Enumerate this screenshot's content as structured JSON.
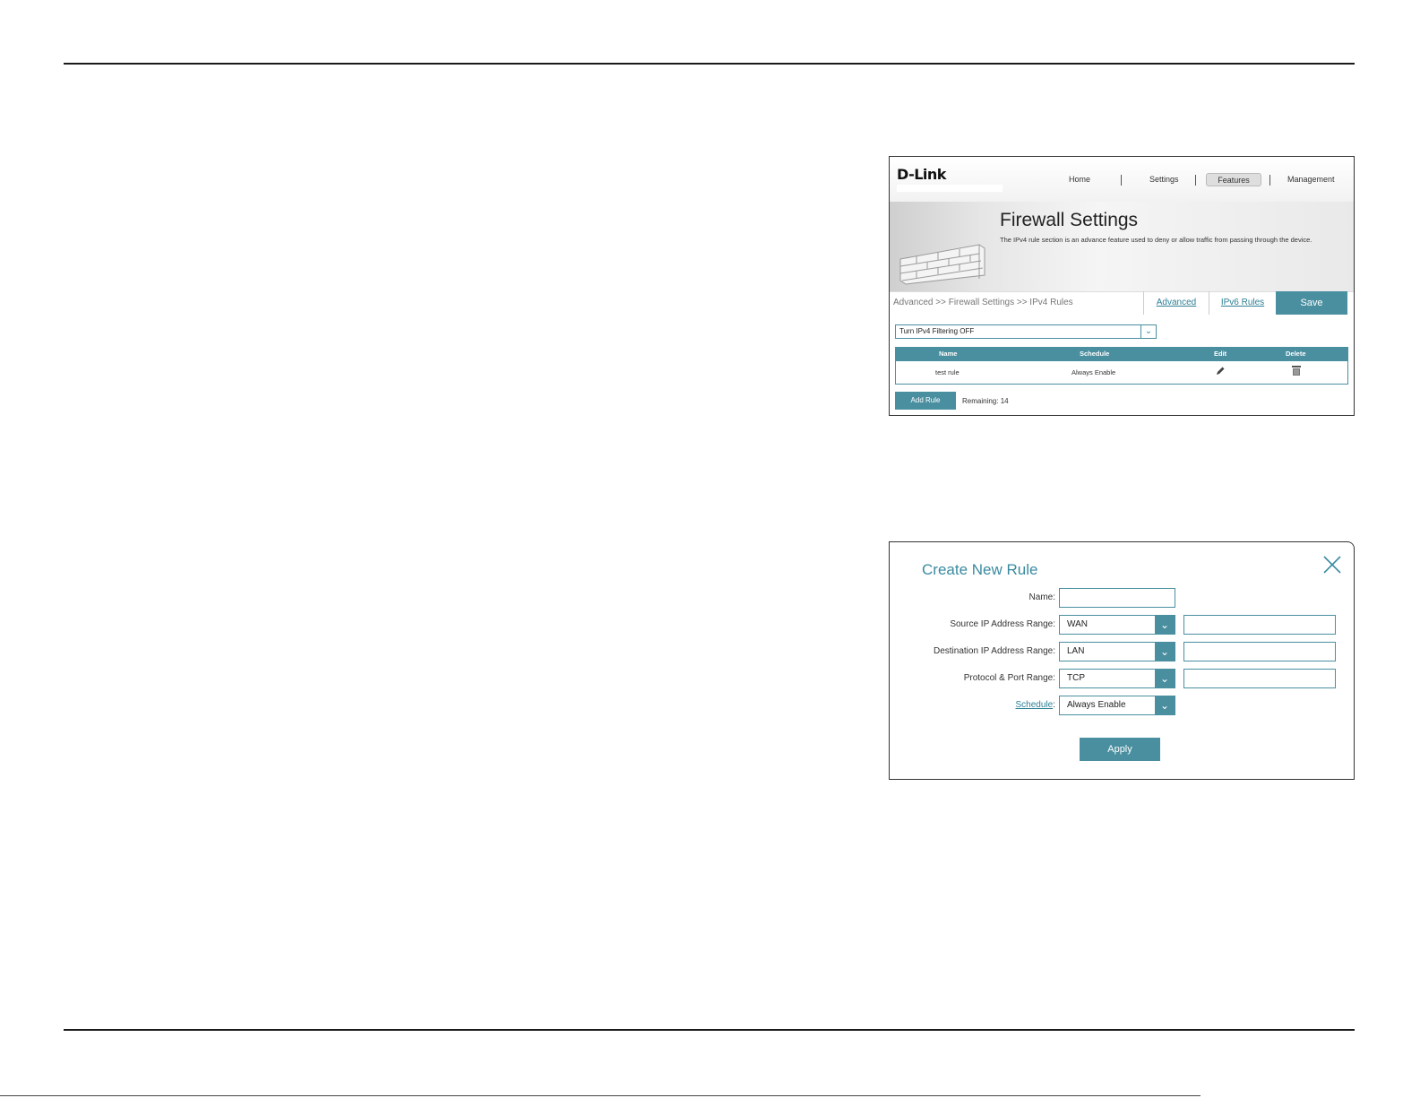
{
  "firewall_screen": {
    "logo": "D-Link",
    "nav": {
      "home": "Home",
      "settings": "Settings",
      "features": "Features",
      "management": "Management"
    },
    "title": "Firewall Settings",
    "description": "The IPv4 rule section is an advance feature used to deny or allow traffic from passing through the device.",
    "breadcrumb": "Advanced >> Firewall Settings >> IPv4 Rules",
    "tabs": {
      "advanced": "Advanced",
      "ipv6_rules": "IPv6 Rules",
      "save": "Save"
    },
    "filter_select": {
      "value": "Turn IPv4 Filtering OFF"
    },
    "table": {
      "headers": [
        "Name",
        "Schedule",
        "Edit",
        "Delete"
      ],
      "rows": [
        {
          "name": "test rule",
          "schedule": "Always Enable"
        }
      ]
    },
    "add_rule_label": "Add Rule",
    "remaining": "Remaining: 14"
  },
  "create_rule_dialog": {
    "title": "Create New Rule",
    "fields": {
      "name_label": "Name:",
      "name_value": "",
      "source_label": "Source IP Address Range:",
      "source_value": "WAN",
      "destination_label": "Destination IP Address Range:",
      "destination_value": "LAN",
      "protocol_label": "Protocol & Port Range:",
      "protocol_value": "TCP",
      "schedule_label": "Schedule",
      "schedule_colon": ":",
      "schedule_value": "Always Enable"
    },
    "apply_label": "Apply"
  },
  "colors": {
    "accent": "#4a8fa0",
    "link": "#2d7f95",
    "title_teal": "#3a8aa0"
  }
}
